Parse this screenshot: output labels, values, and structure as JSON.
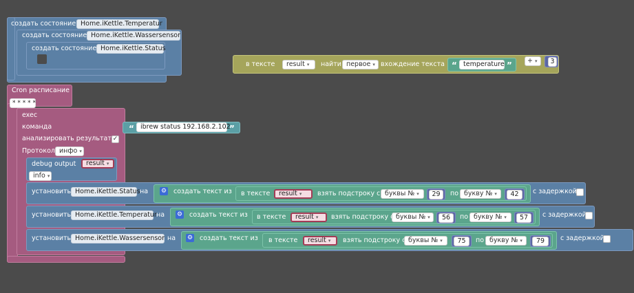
{
  "state_blocks": {
    "label": "создать состояние",
    "row1_state": "Home.iKettle.Temperatur",
    "row2_state": "Home.iKettle.Wassersensor",
    "row3_state": "Home.iKettle.Status"
  },
  "text_block": {
    "in_text": "в тексте",
    "var": "result",
    "find": "найти",
    "which": "первое",
    "occurrence": "вхождение текста",
    "search_text": "temperature",
    "op": "+",
    "num": "3"
  },
  "cron": {
    "label": "Cron расписание",
    "pattern": "* * * * *"
  },
  "exec": {
    "label": "exec",
    "command_label": "команда",
    "command_value": "ibrew status 192.168.2.102",
    "analyze_label": "анализировать результаты",
    "analyze_checked": true,
    "check_mark": "✓",
    "protocol_label": "Протокол",
    "protocol_value": "инфо"
  },
  "debug": {
    "label": "debug output",
    "var": "result",
    "level": "info"
  },
  "set_rows": [
    {
      "set": "установить",
      "state": "Home.iKettle.Status",
      "on": "на",
      "create_text": "создать текст из",
      "in_text": "в тексте",
      "var": "result",
      "substring": "взять подстроку с",
      "from_mode": "буквы №",
      "from": "29",
      "to_prefix": "по",
      "to_mode": "букву №",
      "to": "42",
      "delay": "с задержкой"
    },
    {
      "set": "установить",
      "state": "Home.iKettle.Temperatur",
      "on": "на",
      "create_text": "создать текст из",
      "in_text": "в тексте",
      "var": "result",
      "substring": "взять подстроку с",
      "from_mode": "буквы №",
      "from": "56",
      "to_prefix": "по",
      "to_mode": "букву №",
      "to": "57",
      "delay": "с задержкой"
    },
    {
      "set": "установить",
      "state": "Home.iKettle.Wassersensor",
      "on": "на",
      "create_text": "создать текст из",
      "in_text": "в тексте",
      "var": "result",
      "substring": "взять подстроку с",
      "from_mode": "буквы №",
      "from": "75",
      "to_prefix": "по",
      "to_mode": "букву №",
      "to": "79",
      "delay": "с задержкой"
    }
  ],
  "icons": {
    "dropdown": "▾",
    "gear": "⚙",
    "open_quote": "“",
    "close_quote": "”"
  },
  "colors": {
    "workspace": "#4b4b4b",
    "variable_block": "#5b80a5",
    "cron_block": "#a55b80",
    "text_block": "#5ba58c",
    "find_block": "#a5a55b",
    "number_block": "#5b67a5"
  }
}
